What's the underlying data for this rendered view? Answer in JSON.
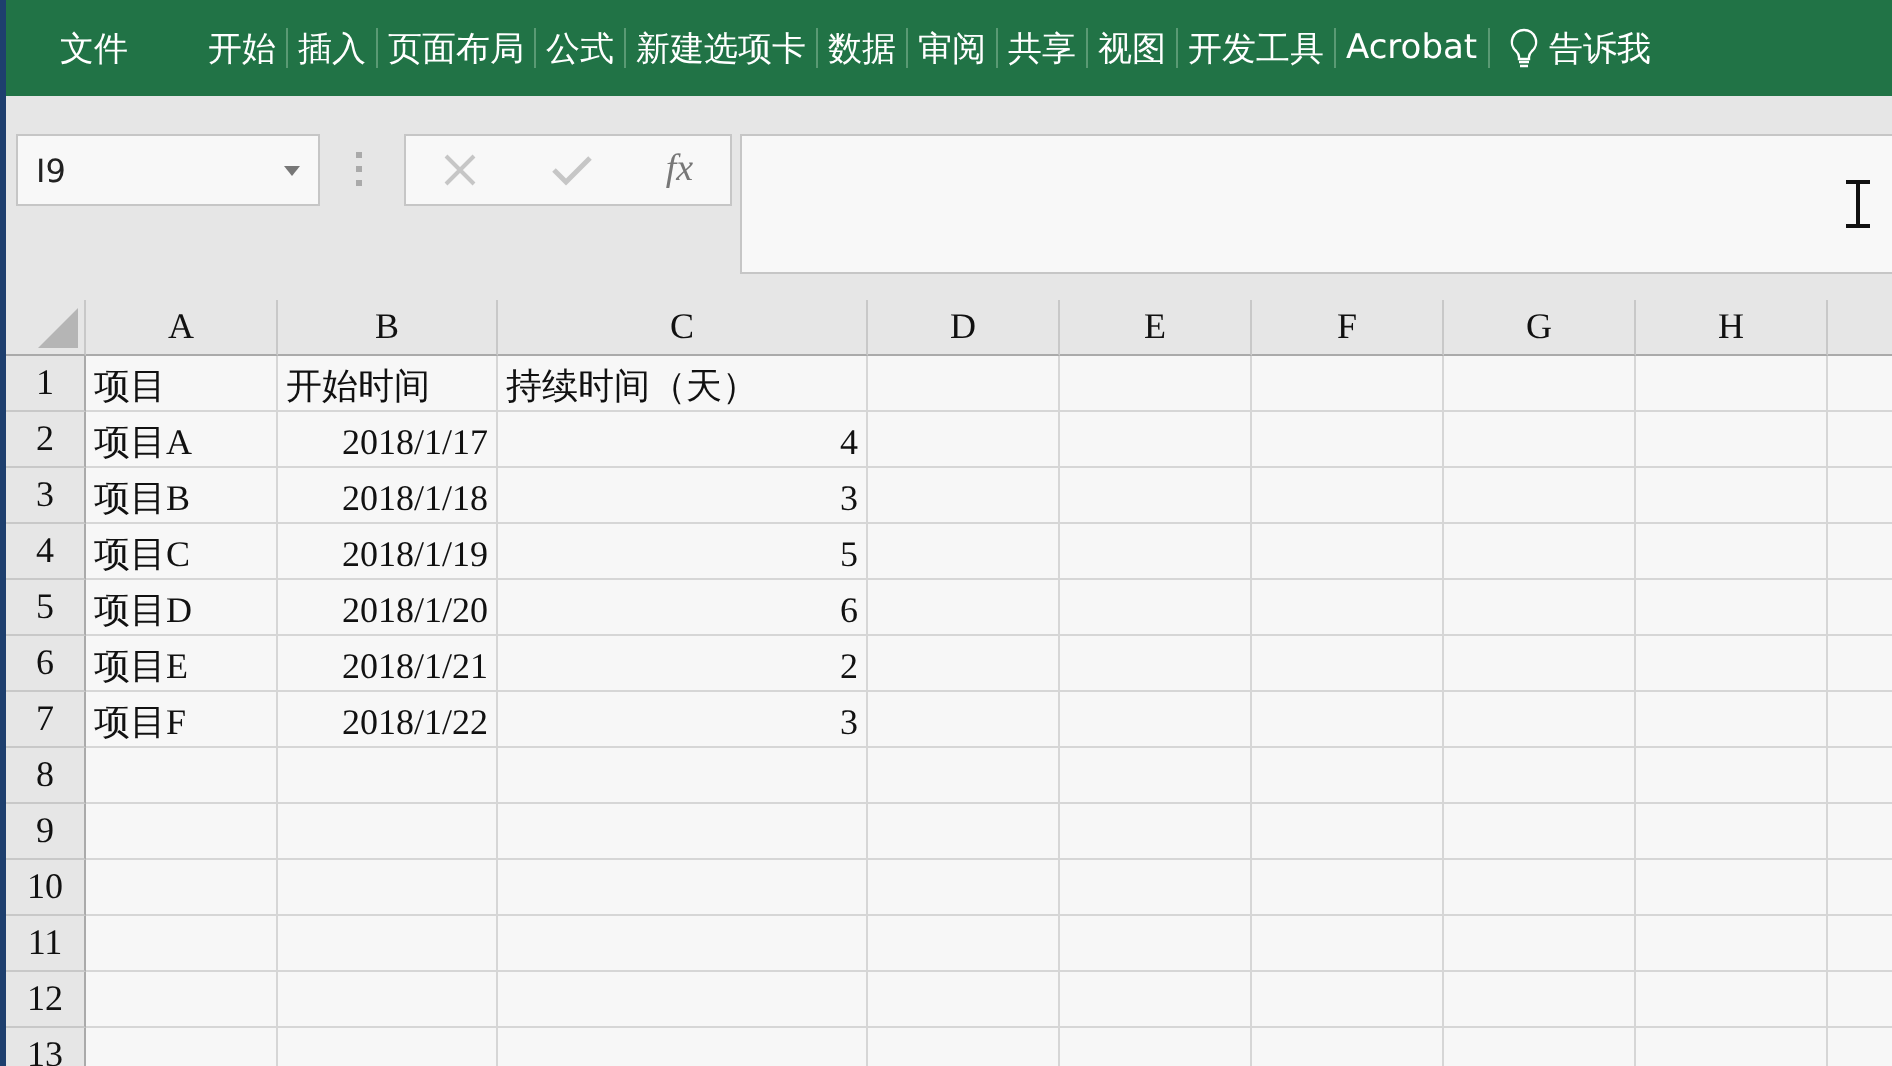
{
  "ribbon": {
    "file_tab": "文件",
    "tabs": [
      {
        "label": "开始",
        "selected": false
      },
      {
        "label": "插入",
        "selected": false
      },
      {
        "label": "页面布局",
        "selected": false
      },
      {
        "label": "公式",
        "selected": false
      },
      {
        "label": "新建选项卡",
        "selected": false
      },
      {
        "label": "数据",
        "selected": false
      },
      {
        "label": "审阅",
        "selected": false
      },
      {
        "label": "共享",
        "selected": false
      },
      {
        "label": "视图",
        "selected": false
      },
      {
        "label": "开发工具",
        "selected": false
      },
      {
        "label": "Acrobat",
        "selected": false
      }
    ],
    "tell_me": "告诉我"
  },
  "formula_bar": {
    "name_box": "I9",
    "fx": "fx"
  },
  "sheet": {
    "columns": [
      "A",
      "B",
      "C",
      "D",
      "E",
      "F",
      "G",
      "H"
    ],
    "rows": [
      {
        "number": "1",
        "cells": [
          {
            "kind": "text",
            "value": "项目"
          },
          {
            "kind": "text",
            "value": "开始时间"
          },
          {
            "kind": "text",
            "value": "持续时间（天）"
          }
        ]
      },
      {
        "number": "2",
        "cells": [
          {
            "kind": "text",
            "value": "项目A"
          },
          {
            "kind": "number",
            "value": "2018/1/17"
          },
          {
            "kind": "number",
            "value": "4"
          }
        ]
      },
      {
        "number": "3",
        "cells": [
          {
            "kind": "text",
            "value": "项目B"
          },
          {
            "kind": "number",
            "value": "2018/1/18"
          },
          {
            "kind": "number",
            "value": "3"
          }
        ]
      },
      {
        "number": "4",
        "cells": [
          {
            "kind": "text",
            "value": "项目C"
          },
          {
            "kind": "number",
            "value": "2018/1/19"
          },
          {
            "kind": "number",
            "value": "5"
          }
        ]
      },
      {
        "number": "5",
        "cells": [
          {
            "kind": "text",
            "value": "项目D"
          },
          {
            "kind": "number",
            "value": "2018/1/20"
          },
          {
            "kind": "number",
            "value": "6"
          }
        ]
      },
      {
        "number": "6",
        "cells": [
          {
            "kind": "text",
            "value": "项目E"
          },
          {
            "kind": "number",
            "value": "2018/1/21"
          },
          {
            "kind": "number",
            "value": "2"
          }
        ]
      },
      {
        "number": "7",
        "cells": [
          {
            "kind": "text",
            "value": "项目F"
          },
          {
            "kind": "number",
            "value": "2018/1/22"
          },
          {
            "kind": "number",
            "value": "3"
          }
        ]
      },
      {
        "number": "8",
        "cells": []
      },
      {
        "number": "9",
        "cells": []
      },
      {
        "number": "10",
        "cells": []
      },
      {
        "number": "11",
        "cells": []
      },
      {
        "number": "12",
        "cells": []
      },
      {
        "number": "13",
        "cells": []
      }
    ]
  }
}
